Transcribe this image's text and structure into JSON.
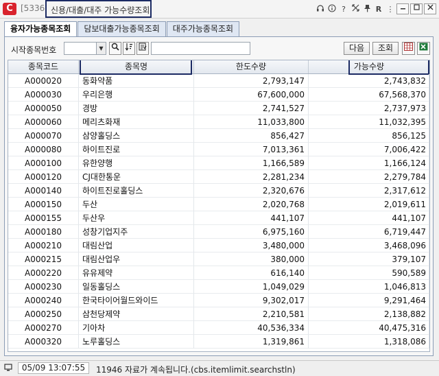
{
  "window": {
    "logo": "C",
    "screen_no": "[5336",
    "title": "신용/대출/대주 가능수량조회",
    "toolbar_icons": [
      "headset-icon",
      "info-icon",
      "help-icon",
      "move-icon",
      "pin-icon",
      "r-icon",
      "more-icon"
    ],
    "toolbar_labels": [
      "?",
      "R"
    ]
  },
  "tabs": [
    {
      "label": "융자가능종목조회",
      "active": true
    },
    {
      "label": "담보대출가능종목조회",
      "active": false
    },
    {
      "label": "대주가능종목조회",
      "active": false
    }
  ],
  "search": {
    "label": "시작종목번호",
    "code_value": "",
    "name_value": "",
    "next_label": "다음",
    "query_label": "조회"
  },
  "table": {
    "headers": [
      "종목코드",
      "종목명",
      "한도수량",
      "가능수량"
    ],
    "rows": [
      {
        "code": "A000020",
        "name": "동화약품",
        "limit": "2,793,147",
        "avail": "2,743,832"
      },
      {
        "code": "A000030",
        "name": "우리은행",
        "limit": "67,600,000",
        "avail": "67,568,370"
      },
      {
        "code": "A000050",
        "name": "경방",
        "limit": "2,741,527",
        "avail": "2,737,973"
      },
      {
        "code": "A000060",
        "name": "메리츠화재",
        "limit": "11,033,800",
        "avail": "11,032,395"
      },
      {
        "code": "A000070",
        "name": "삼양홀딩스",
        "limit": "856,427",
        "avail": "856,125"
      },
      {
        "code": "A000080",
        "name": "하이트진로",
        "limit": "7,013,361",
        "avail": "7,006,422"
      },
      {
        "code": "A000100",
        "name": "유한양행",
        "limit": "1,166,589",
        "avail": "1,166,124"
      },
      {
        "code": "A000120",
        "name": "CJ대한통운",
        "limit": "2,281,234",
        "avail": "2,279,784"
      },
      {
        "code": "A000140",
        "name": "하이트진로홀딩스",
        "limit": "2,320,676",
        "avail": "2,317,612"
      },
      {
        "code": "A000150",
        "name": "두산",
        "limit": "2,020,768",
        "avail": "2,019,611"
      },
      {
        "code": "A000155",
        "name": "두산우",
        "limit": "441,107",
        "avail": "441,107"
      },
      {
        "code": "A000180",
        "name": "성창기업지주",
        "limit": "6,975,160",
        "avail": "6,719,447"
      },
      {
        "code": "A000210",
        "name": "대림산업",
        "limit": "3,480,000",
        "avail": "3,468,096"
      },
      {
        "code": "A000215",
        "name": "대림산업우",
        "limit": "380,000",
        "avail": "379,107"
      },
      {
        "code": "A000220",
        "name": "유유제약",
        "limit": "616,140",
        "avail": "590,589"
      },
      {
        "code": "A000230",
        "name": "일동홀딩스",
        "limit": "1,049,029",
        "avail": "1,046,813"
      },
      {
        "code": "A000240",
        "name": "한국타이어월드와이드",
        "limit": "9,302,017",
        "avail": "9,291,464"
      },
      {
        "code": "A000250",
        "name": "삼천당제약",
        "limit": "2,210,581",
        "avail": "2,138,882"
      },
      {
        "code": "A000270",
        "name": "기아차",
        "limit": "40,536,334",
        "avail": "40,475,316"
      },
      {
        "code": "A000320",
        "name": "노루홀딩스",
        "limit": "1,319,861",
        "avail": "1,318,086"
      }
    ]
  },
  "status": {
    "time": "05/09  13:07:55",
    "message": "11946 자료가  계속됩니다.(cbs.itemlimit.searchstln)"
  },
  "colors": {
    "accent": "#1b2a63",
    "logo": "#d9232d"
  }
}
